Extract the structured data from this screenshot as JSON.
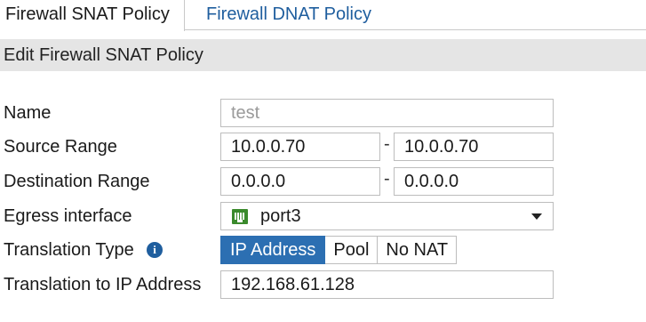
{
  "tabs": [
    {
      "label": "Firewall SNAT Policy",
      "active": true
    },
    {
      "label": "Firewall DNAT Policy",
      "active": false
    }
  ],
  "section": {
    "title": "Edit Firewall SNAT Policy"
  },
  "form": {
    "name": {
      "label": "Name",
      "value": "test"
    },
    "source_range": {
      "label": "Source Range",
      "start": "10.0.0.70",
      "separator": "-",
      "end": "10.0.0.70"
    },
    "destination_range": {
      "label": "Destination Range",
      "start": "0.0.0.0",
      "separator": "-",
      "end": "0.0.0.0"
    },
    "egress_interface": {
      "label": "Egress interface",
      "value": "port3",
      "icon": "ethernet-port-icon"
    },
    "translation_type": {
      "label": "Translation Type",
      "info_icon": "i",
      "options": [
        "IP Address",
        "Pool",
        "No NAT"
      ],
      "selected": "IP Address"
    },
    "translation_ip": {
      "label": "Translation to IP Address",
      "value": "192.168.61.128"
    }
  },
  "colors": {
    "accent": "#2c6fb2",
    "link": "#1f5e9e",
    "header_bg": "#e5e5e5",
    "port_icon": "#3a8a2c"
  }
}
